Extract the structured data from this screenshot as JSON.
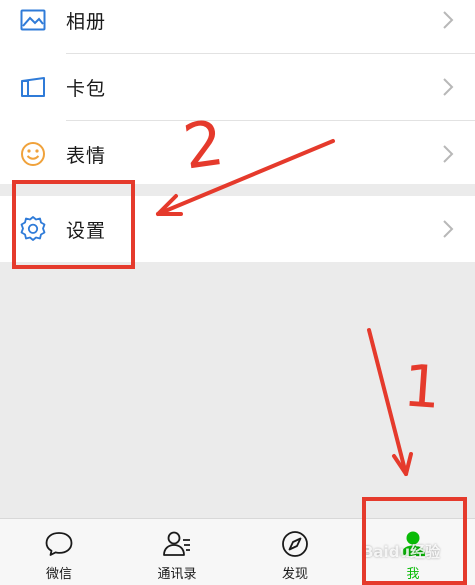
{
  "menu": {
    "items": [
      {
        "label": "相册",
        "icon": "album-icon"
      },
      {
        "label": "卡包",
        "icon": "card-wallet-icon"
      },
      {
        "label": "表情",
        "icon": "emoji-icon"
      },
      {
        "label": "设置",
        "icon": "gear-icon"
      }
    ]
  },
  "tabbar": {
    "tabs": [
      {
        "label": "微信",
        "icon": "chat-bubble-icon"
      },
      {
        "label": "通讯录",
        "icon": "contacts-icon"
      },
      {
        "label": "发现",
        "icon": "compass-icon"
      },
      {
        "label": "我",
        "icon": "person-icon",
        "active": true
      }
    ]
  },
  "annotations": {
    "step1": "1",
    "step2": "2"
  },
  "watermark": "Baidu经验",
  "colors": {
    "accent": "#09bb07",
    "annotation_red": "#e53a2c",
    "icon_blue": "#2f7bd8",
    "emoji_orange": "#f0a23b"
  }
}
